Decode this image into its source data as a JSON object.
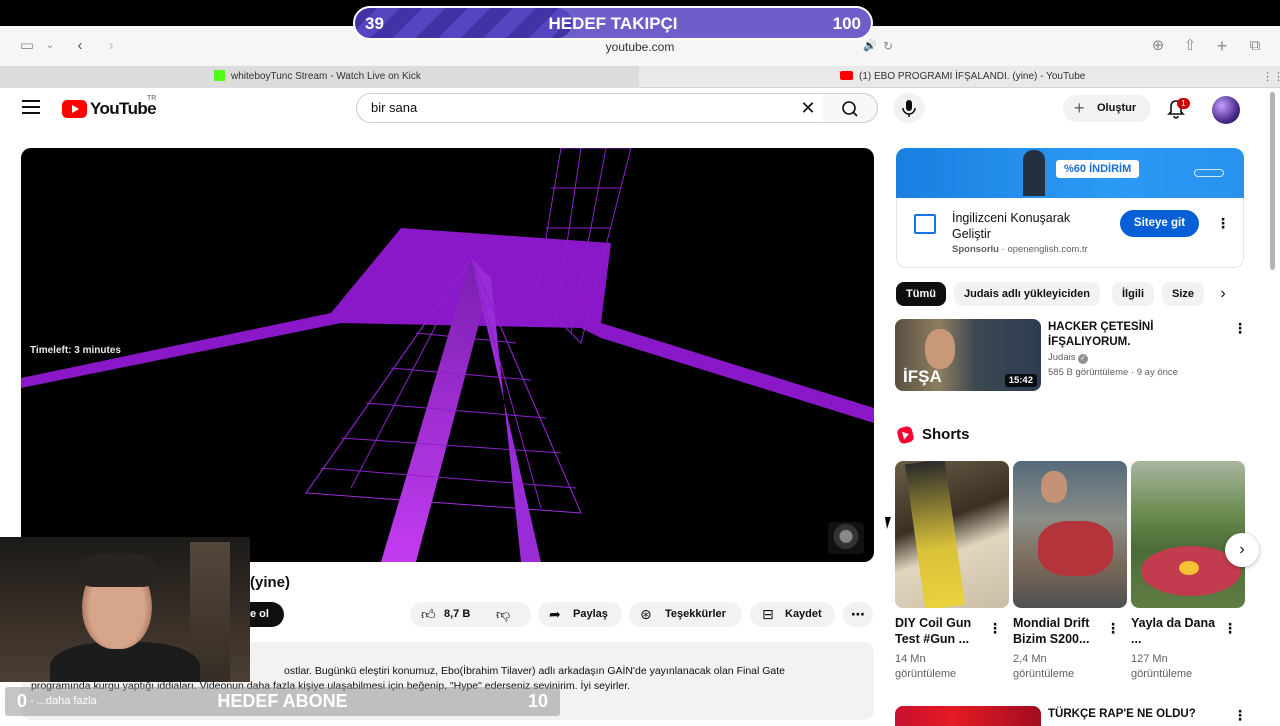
{
  "stream_overlay": {
    "top_goal": {
      "current": "39",
      "label": "HEDEF TAKIPÇI",
      "target": "100",
      "progress": 0.39
    },
    "bottom_goal": {
      "current": "0",
      "label": "HEDEF ABONE",
      "target": "10",
      "progress": 0.0
    }
  },
  "browser": {
    "address": "youtube.com",
    "tabs": [
      {
        "title": "whiteboyTunc Stream - Watch Live on Kick",
        "active": false
      },
      {
        "title": "(1) EBO PROGRAMI İFŞALANDI. (yine) - YouTube",
        "active": true
      }
    ]
  },
  "header": {
    "logo_text": "YouTube",
    "region": "TR",
    "search_value": "bir sana",
    "create_label": "Oluştur",
    "notification_count": "1"
  },
  "player": {
    "overlay_text": "Timeleft: 3 minutes"
  },
  "video": {
    "title_visible": "(yine)",
    "subscribe_label": "e ol",
    "likes": "8,7 B",
    "share_label": "Paylaş",
    "thanks_label": "Teşekkürler",
    "save_label": "Kaydet",
    "desc_line1": "ostlar. Bugünkü eleştiri konumuz, Ebo(İbrahim Tilaver) adlı arkadaşın GAİN'de yayınlanacak olan Final Gate",
    "desc_line2": "programında kurgu yaptığı iddiaları. Videonun daha fazla kişiye ulaşabilmesi için beğenip, \"Hype\" ederseniz sevinirim. İyi seyirler.",
    "more_label": "...daha fazla"
  },
  "sidebar": {
    "ad": {
      "banner_text": "%60 İNDİRİM",
      "title": "İngilizceni Konuşarak Geliştir",
      "sponsored": "Sponsorlu",
      "domain": "openenglish.com.tr",
      "cta": "Siteye git"
    },
    "chips": [
      "Tümü",
      "Judais adlı yükleyiciden",
      "İlgili",
      "Size"
    ],
    "rec1": {
      "title": "HACKER ÇETESİNİ İFŞALIYORUM.",
      "channel": "Judais",
      "views": "585 B görüntüleme",
      "age": "9 ay önce",
      "duration": "15:42",
      "thumb_text": "İFŞA"
    },
    "shorts_title": "Shorts",
    "shorts": [
      {
        "title": "DIY Coil Gun Test #Gun ...",
        "views": "14 Mn",
        "views_label": "görüntüleme"
      },
      {
        "title": "Mondial Drift Bizim S200...",
        "views": "2,4 Mn",
        "views_label": "görüntüleme"
      },
      {
        "title": "Yayla da Dana ...",
        "views": "127 Mn",
        "views_label": "görüntüleme"
      }
    ],
    "rec2": {
      "title": "TÜRKÇE RAP'E NE OLDU?"
    }
  }
}
